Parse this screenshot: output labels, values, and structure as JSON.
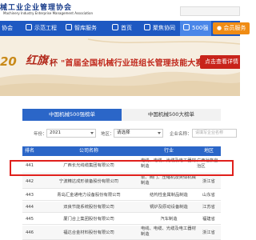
{
  "header": {
    "logo": "械工业企业管理协会",
    "logo_sub": "Machinery Industry Enterprise Management Association",
    "search_placeholder": ""
  },
  "nav": {
    "items": [
      {
        "label": "协会"
      },
      {
        "label": "示范工程"
      },
      {
        "label": "智库服务"
      },
      {
        "label": "首页"
      },
      {
        "label": "聚焦协同"
      },
      {
        "label": "500强"
      },
      {
        "label": "会员服务"
      }
    ]
  },
  "banner": {
    "year": "20",
    "script": "红旗",
    "cup": "杯",
    "title": "\"首届全国机械行业班组长管理技能大赛",
    "cta": "点击查看详情"
  },
  "tabs": [
    {
      "label": "中国机械500强榜单"
    },
    {
      "label": "中国机械500大榜单"
    }
  ],
  "filters": {
    "year_label": "年份：",
    "year_value": "2021",
    "region_label": "地区：",
    "region_value": "请选择",
    "company_label": "企业名称：",
    "company_placeholder": "请填写企业名称"
  },
  "table": {
    "headers": [
      "排名",
      "公司名称",
      "行业",
      "地区"
    ],
    "rows": [
      {
        "rank": "441",
        "name": "广西长光线缆集团有限公司",
        "industry": "电线、电缆、光缆及电工器材制造",
        "region": "广西壮族自治区"
      },
      {
        "rank": "442",
        "name": "宁波精达成形装备股份有限公司",
        "industry": "泵、阀门、压缩机及类似机械制造",
        "region": "浙江省"
      },
      {
        "rank": "443",
        "name": "青岛汇金通电力设备股份有限公司",
        "industry": "结构性金属制品制造",
        "region": "山东省"
      },
      {
        "rank": "444",
        "name": "双良节能系统股份有限公司",
        "industry": "锅炉及原动设备制造",
        "region": "江苏省"
      },
      {
        "rank": "445",
        "name": "厦门合上集团股份有限公司",
        "industry": "汽车制造",
        "region": "福建省"
      },
      {
        "rank": "446",
        "name": "福达合金材料股份有限公司",
        "industry": "电线、电缆、光缆及电工器材制造",
        "region": "浙江省"
      }
    ]
  },
  "colors": {
    "nav_bg": "#1e59c2",
    "nav_active": "#4a86e8",
    "vip_bg": "#f08c14",
    "banner_red": "#c0281c",
    "tab_active": "#2b66c8",
    "highlight": "#e0201c"
  }
}
